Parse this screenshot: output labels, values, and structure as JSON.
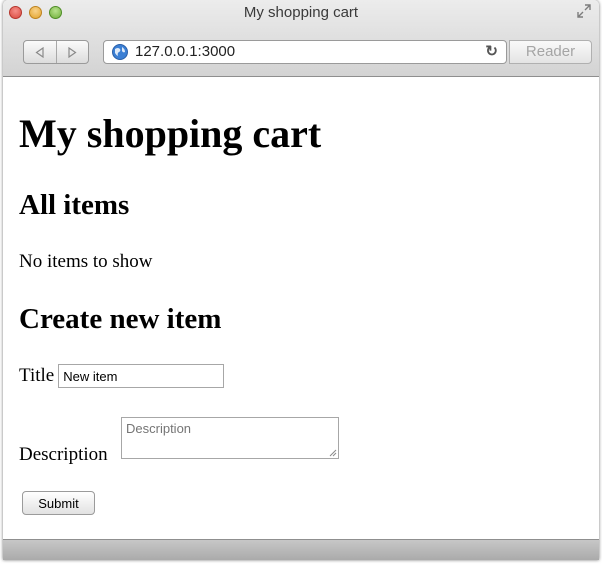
{
  "browser": {
    "window_title": "My shopping cart",
    "url": "127.0.0.1:3000",
    "reader_label": "Reader",
    "icons": {
      "back": "back-arrow-icon",
      "forward": "forward-arrow-icon",
      "site": "globe-icon",
      "reload": "reload-icon",
      "fullscreen": "fullscreen-icon"
    }
  },
  "page": {
    "heading": "My shopping cart",
    "items_heading": "All items",
    "empty_message": "No items to show",
    "create_heading": "Create new item",
    "form": {
      "title_label": "Title",
      "title_value": "New item",
      "description_label": "Description",
      "description_placeholder": "Description",
      "submit_label": "Submit"
    }
  }
}
